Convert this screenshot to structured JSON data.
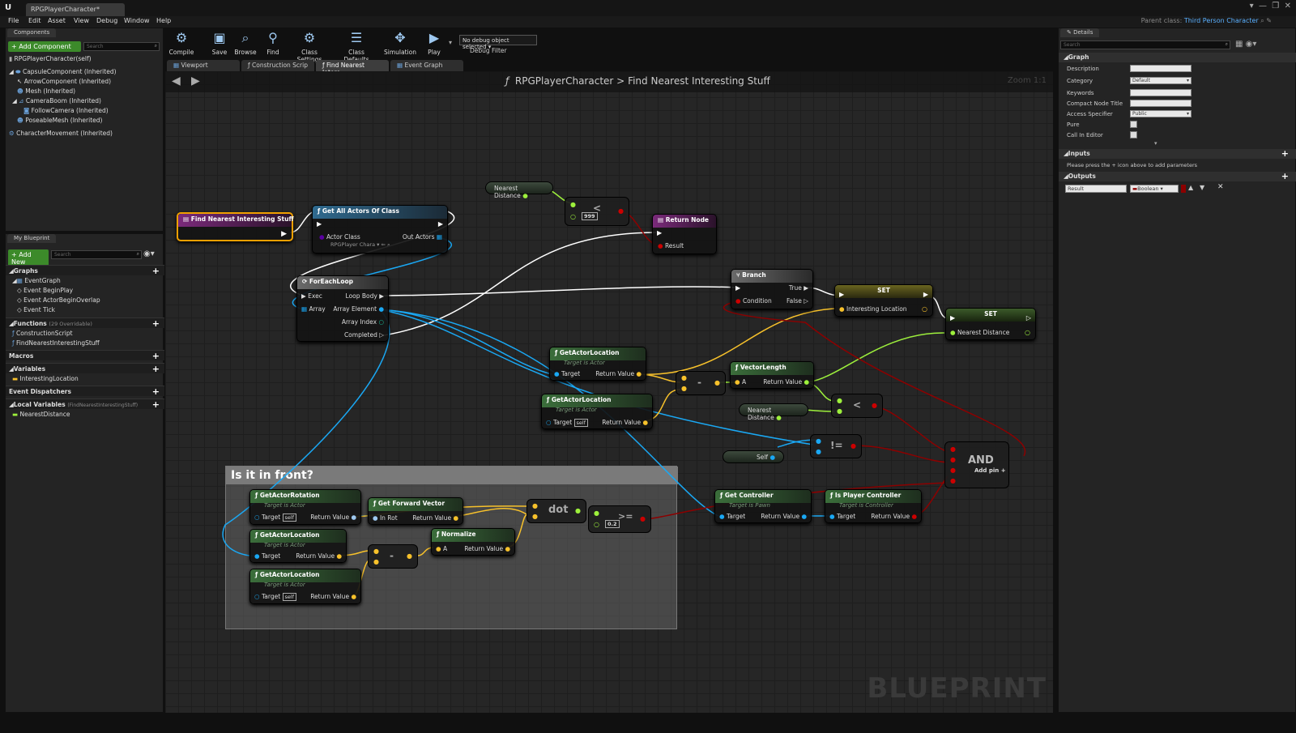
{
  "window": {
    "title": "RPGPlayerCharacter",
    "parent_class_label": "Parent class:",
    "parent_class_value": "Third Person Character"
  },
  "menu": [
    "File",
    "Edit",
    "Asset",
    "View",
    "Debug",
    "Window",
    "Help"
  ],
  "components_panel": {
    "tab": "Components",
    "add_button": "+ Add Component",
    "search_placeholder": "Search",
    "root": "RPGPlayerCharacter(self)",
    "items": [
      "CapsuleComponent (Inherited)",
      "ArrowComponent (Inherited)",
      "Mesh (Inherited)",
      "CameraBoom (Inherited)",
      "FollowCamera (Inherited)",
      "PoseableMesh (Inherited)",
      "CharacterMovement (Inherited)"
    ]
  },
  "my_blueprint": {
    "tab": "My Blueprint",
    "add_button": "+ Add New",
    "search_placeholder": "Search",
    "graphs_label": "Graphs",
    "event_graph": "EventGraph",
    "events": [
      "Event BeginPlay",
      "Event ActorBeginOverlap",
      "Event Tick"
    ],
    "functions_label": "Functions",
    "functions_count": "(29 Overridable)",
    "functions": [
      "ConstructionScript",
      "FindNearestInterestingStuff"
    ],
    "macros_label": "Macros",
    "variables_label": "Variables",
    "variables": [
      "InterestingLocation"
    ],
    "dispatchers_label": "Event Dispatchers",
    "local_label": "Local Variables",
    "local_scope": "(FindNearestInterestingStuff)",
    "local_vars": [
      "NearestDistance"
    ]
  },
  "toolbar": {
    "compile": "Compile",
    "save": "Save",
    "browse": "Browse",
    "find": "Find",
    "class_settings": "Class Settings",
    "class_defaults": "Class Defaults",
    "simulation": "Simulation",
    "play": "Play",
    "debug_select": "No debug object selected",
    "debug_label": "Debug Filter"
  },
  "graph_tabs": [
    "Viewport",
    "Construction Scrip",
    "Find Nearest Intere",
    "Event Graph"
  ],
  "graph": {
    "breadcrumb_class": "RPGPlayerCharacter",
    "breadcrumb_sep": ">",
    "breadcrumb_fn": "Find Nearest Interesting Stuff",
    "zoom": "Zoom 1:1",
    "watermark": "BLUEPRINT",
    "comment": "Is it in front?"
  },
  "nodes": {
    "entry": "Find Nearest Interesting Stuff",
    "get_all": {
      "title": "Get All Actors Of Class",
      "actor_class": "Actor Class",
      "class_value": "RPGPlayer Chara",
      "out": "Out Actors"
    },
    "foreach": {
      "title": "ForEachLoop",
      "exec": "Exec",
      "array": "Array",
      "loop_body": "Loop Body",
      "array_element": "Array Element",
      "array_index": "Array Index",
      "completed": "Completed"
    },
    "nearest_var": "Nearest Distance",
    "less_const": "999",
    "return": {
      "title": "Return Node",
      "result": "Result"
    },
    "branch": {
      "title": "Branch",
      "condition": "Condition",
      "true": "True",
      "false": "False"
    },
    "set1": {
      "title": "SET",
      "pin": "Interesting Location"
    },
    "set2": {
      "title": "SET",
      "pin": "Nearest Distance"
    },
    "gal1": {
      "title": "GetActorLocation",
      "sub": "Target is Actor",
      "target": "Target",
      "ret": "Return Value"
    },
    "gal2": {
      "title": "GetActorLocation",
      "sub": "Target is Actor",
      "target": "Target",
      "self": "self",
      "ret": "Return Value"
    },
    "minus": "-",
    "vlen": {
      "title": "VectorLength",
      "a": "A",
      "ret": "Return Value"
    },
    "less": "<",
    "nearest_var2": "Nearest Distance",
    "neq": "!=",
    "self_node": "Self",
    "and": {
      "title": "AND",
      "add": "Add pin"
    },
    "get_controller": {
      "title": "Get Controller",
      "sub": "Target is Pawn",
      "target": "Target",
      "ret": "Return Value"
    },
    "is_player": {
      "title": "Is Player Controller",
      "sub": "Target is Controller",
      "target": "Target",
      "ret": "Return Value"
    },
    "gar": {
      "title": "GetActorRotation",
      "sub": "Target is Actor",
      "target": "Target",
      "self": "self",
      "ret": "Return Value"
    },
    "gfv": {
      "title": "Get Forward Vector",
      "in": "In Rot",
      "ret": "Return Value"
    },
    "dot": "dot",
    "ge_const": "0.2",
    "gal3": {
      "title": "GetActorLocation",
      "sub": "Target is Actor",
      "target": "Target",
      "ret": "Return Value"
    },
    "minus2": "-",
    "norm": {
      "title": "Normalize",
      "a": "A",
      "ret": "Return Value"
    },
    "gal4": {
      "title": "GetActorLocation",
      "sub": "Target is Actor",
      "target": "Target",
      "self": "self",
      "ret": "Return Value"
    }
  },
  "details": {
    "tab": "Details",
    "search_placeholder": "Search",
    "graph_label": "Graph",
    "fields": [
      {
        "label": "Description",
        "value": ""
      },
      {
        "label": "Category",
        "value": "Default"
      },
      {
        "label": "Keywords",
        "value": ""
      },
      {
        "label": "Compact Node Title",
        "value": ""
      },
      {
        "label": "Access Specifier",
        "value": "Public"
      }
    ],
    "pure": "Pure",
    "call_in_editor": "Call In Editor",
    "inputs_label": "Inputs",
    "inputs_hint": "Please press the + icon above to add parameters",
    "outputs_label": "Outputs",
    "output_name": "Result",
    "output_type": "Boolean"
  },
  "colors": {
    "exec": "#ffffff",
    "bool": "#8c0000",
    "float": "#9df03c",
    "vector": "#f7c12b",
    "object": "#00a8f4",
    "class": "#5a00a0"
  }
}
